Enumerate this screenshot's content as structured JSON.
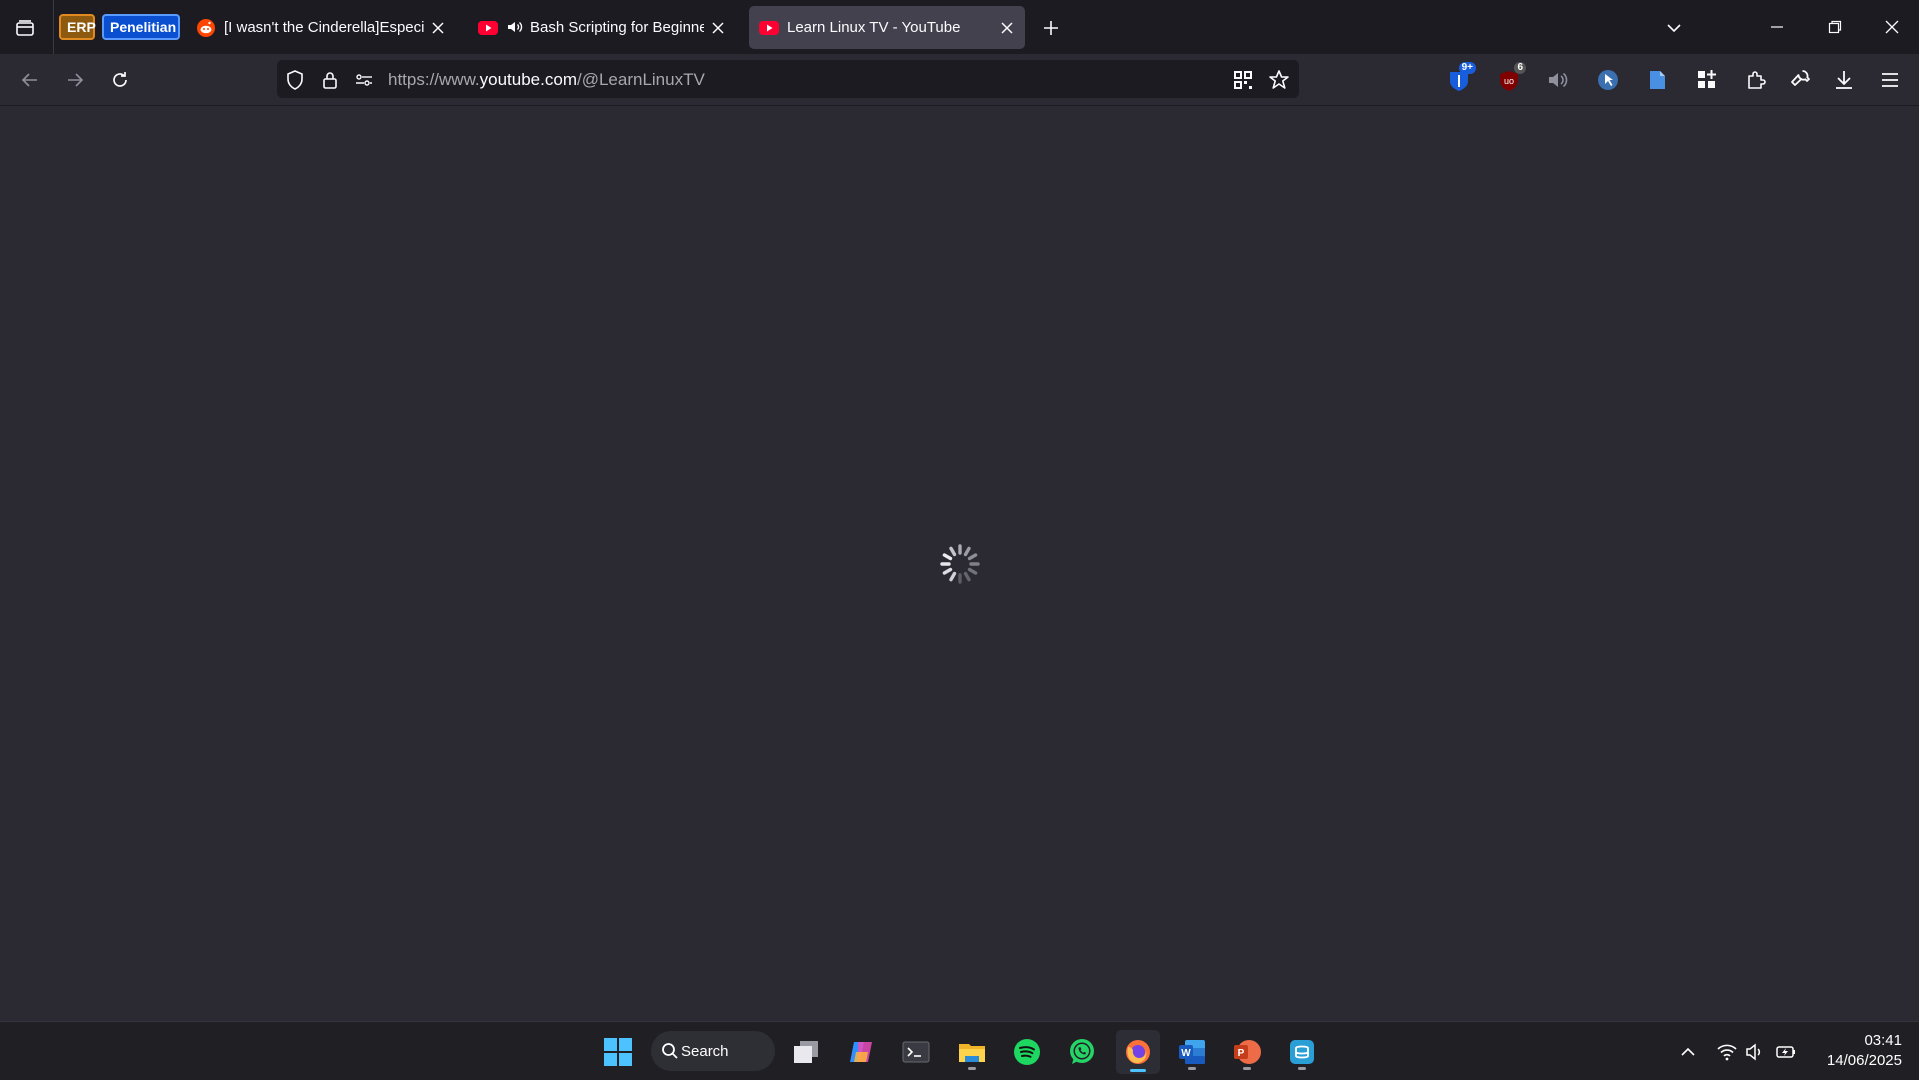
{
  "tab_groups": [
    {
      "label": "ERP",
      "color": "#8e5a10"
    },
    {
      "label": "Penelitian",
      "color": "#0a4fd0"
    }
  ],
  "tabs": [
    {
      "title": "[I wasn't the Cinderella]Especially",
      "favicon": "reddit-icon",
      "active": false
    },
    {
      "title": "Bash Scripting for Beginners",
      "favicon": "youtube-icon",
      "playing_audio": true,
      "active": false
    },
    {
      "title": "Learn Linux TV - YouTube",
      "favicon": "youtube-icon",
      "active": true
    }
  ],
  "url": {
    "scheme": "https://www.",
    "host": "youtube.com",
    "path": "/@LearnLinuxTV"
  },
  "extensions": [
    {
      "name": "bitwarden-icon",
      "badge": "9+"
    },
    {
      "name": "ublock-icon",
      "badge": "6"
    }
  ],
  "taskbar": {
    "search_label": "Search"
  },
  "clock": {
    "time": "03:41",
    "date": "14/06/2025"
  },
  "colors": {
    "accent": "#4cc2ff",
    "youtube_red": "#ff0033",
    "reddit_orange": "#ff4500"
  }
}
